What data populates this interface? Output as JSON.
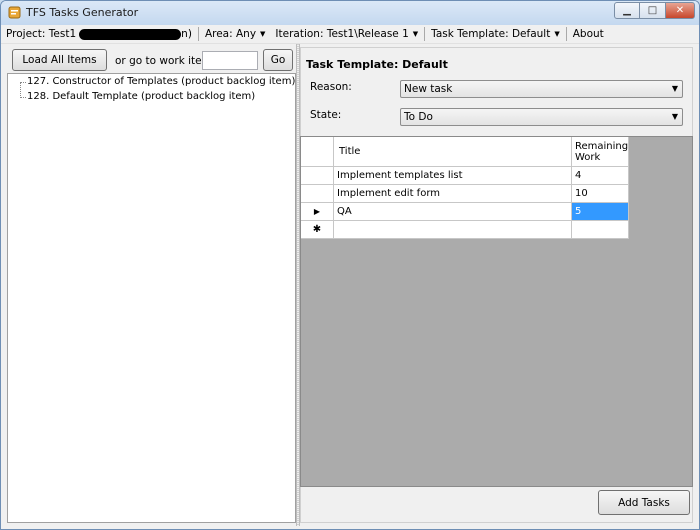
{
  "window": {
    "title": "TFS Tasks Generator"
  },
  "menu": {
    "project_label": "Project: Test1",
    "project_suffix": "n)",
    "area": "Area: Any",
    "iteration": "Iteration: Test1\\Release 1",
    "task_template": "Task Template: Default",
    "about": "About"
  },
  "left": {
    "load_all_label": "Load All Items",
    "goto_label": "or go to work item",
    "goto_value": "",
    "go_label": "Go",
    "tree_items": [
      "127. Constructor of Templates (product backlog item)",
      "128. Default Template (product backlog item)"
    ]
  },
  "right": {
    "template_title": "Task Template: Default",
    "reason_label": "Reason:",
    "reason_value": "New task",
    "state_label": "State:",
    "state_value": "To Do",
    "grid": {
      "col_title": "Title",
      "col_remaining_1": "Remaining",
      "col_remaining_2": "Work",
      "rows": [
        {
          "title": "Implement templates list",
          "remaining": "4"
        },
        {
          "title": "Implement edit form",
          "remaining": "10"
        },
        {
          "title": "QA",
          "remaining": "5"
        }
      ],
      "current_row_marker": "▶",
      "new_row_marker": "✱"
    },
    "add_tasks_label": "Add Tasks"
  },
  "colors": {
    "selection": "#3399ff",
    "grid_background": "#ababab"
  }
}
